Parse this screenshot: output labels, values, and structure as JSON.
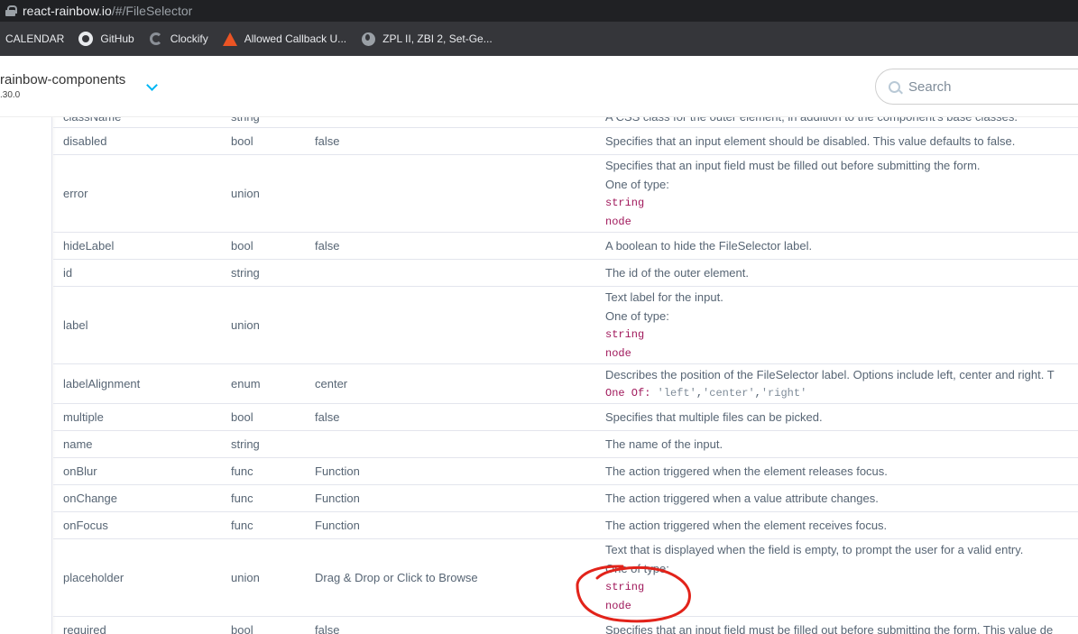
{
  "browser": {
    "url_host": "react-rainbow.io",
    "url_path": "/#/FileSelector",
    "bookmarks": [
      {
        "label": "CALENDAR",
        "icon": "none"
      },
      {
        "label": "GitHub",
        "icon": "github-icon"
      },
      {
        "label": "Clockify",
        "icon": "clockify-icon"
      },
      {
        "label": "Allowed Callback U...",
        "icon": "auth0-icon"
      },
      {
        "label": "ZPL II, ZBI 2, Set-Ge...",
        "icon": "globe-icon"
      }
    ]
  },
  "header": {
    "brand": "rainbow-components",
    "version": ".30.0",
    "search_placeholder": "Search"
  },
  "colors": {
    "accent": "#01b6f5",
    "code": "#a0185b",
    "text": "#576574",
    "annotation": "#e2231a"
  },
  "props": [
    {
      "name": "className",
      "type": "string",
      "default": "",
      "desc": [
        "A CSS class for the outer element, in addition to the component's base classes."
      ],
      "h": 24
    },
    {
      "name": "disabled",
      "type": "bool",
      "default": "false",
      "desc": [
        "Specifies that an input element should be disabled. This value defaults to false."
      ]
    },
    {
      "name": "error",
      "type": "union",
      "default": "",
      "desc": [
        "Specifies that an input field must be filled out before submitting the form.",
        "One of type:"
      ],
      "codes": [
        "string",
        "node"
      ]
    },
    {
      "name": "hideLabel",
      "type": "bool",
      "default": "false",
      "desc": [
        "A boolean to hide the FileSelector label."
      ]
    },
    {
      "name": "id",
      "type": "string",
      "default": "",
      "desc": [
        "The id of the outer element."
      ]
    },
    {
      "name": "label",
      "type": "union",
      "default": "",
      "desc": [
        "Text label for the input.",
        "One of type:"
      ],
      "codes": [
        "string",
        "node"
      ]
    },
    {
      "name": "labelAlignment",
      "type": "enum",
      "default": "center",
      "desc": [
        "Describes the position of the FileSelector label. Options include left, center and right. T"
      ],
      "oneof": {
        "label": "One Of:",
        "values": [
          "'left'",
          "'center'",
          "'right'"
        ]
      }
    },
    {
      "name": "multiple",
      "type": "bool",
      "default": "false",
      "desc": [
        "Specifies that multiple files can be picked."
      ]
    },
    {
      "name": "name",
      "type": "string",
      "default": "",
      "desc": [
        "The name of the input."
      ]
    },
    {
      "name": "onBlur",
      "type": "func",
      "default": "Function",
      "desc": [
        "The action triggered when the element releases focus."
      ]
    },
    {
      "name": "onChange",
      "type": "func",
      "default": "Function",
      "desc": [
        "The action triggered when a value attribute changes."
      ]
    },
    {
      "name": "onFocus",
      "type": "func",
      "default": "Function",
      "desc": [
        "The action triggered when the element receives focus."
      ]
    },
    {
      "name": "placeholder",
      "type": "union",
      "default": "Drag & Drop or Click to Browse",
      "desc": [
        "Text that is displayed when the field is empty, to prompt the user for a valid entry.",
        "One of type:"
      ],
      "codes": [
        "string",
        "node"
      ]
    },
    {
      "name": "required",
      "type": "bool",
      "default": "false",
      "desc": [
        "Specifies that an input field must be filled out before submitting the form. This value de"
      ]
    }
  ]
}
